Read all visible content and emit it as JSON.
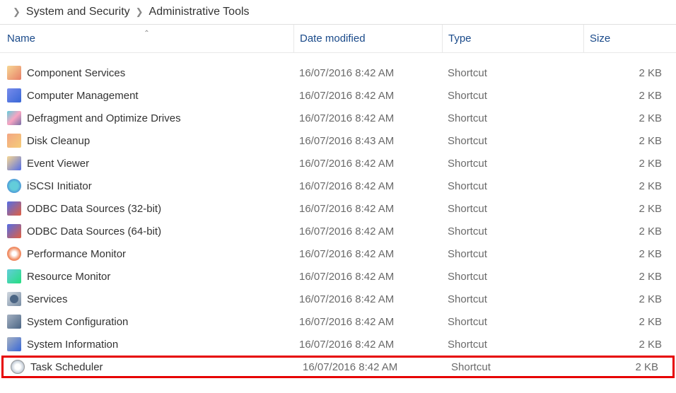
{
  "breadcrumb": {
    "segment1": "System and Security",
    "segment2": "Administrative Tools"
  },
  "columns": {
    "name": "Name",
    "date": "Date modified",
    "type": "Type",
    "size": "Size"
  },
  "items": [
    {
      "icon": "component-services-icon",
      "iconClass": "ico-component",
      "name": "Component Services",
      "date": "16/07/2016 8:42 AM",
      "type": "Shortcut",
      "size": "2 KB"
    },
    {
      "icon": "computer-management-icon",
      "iconClass": "ico-computer",
      "name": "Computer Management",
      "date": "16/07/2016 8:42 AM",
      "type": "Shortcut",
      "size": "2 KB"
    },
    {
      "icon": "defragment-icon",
      "iconClass": "ico-defrag",
      "name": "Defragment and Optimize Drives",
      "date": "16/07/2016 8:42 AM",
      "type": "Shortcut",
      "size": "2 KB"
    },
    {
      "icon": "disk-cleanup-icon",
      "iconClass": "ico-disk",
      "name": "Disk Cleanup",
      "date": "16/07/2016 8:43 AM",
      "type": "Shortcut",
      "size": "2 KB"
    },
    {
      "icon": "event-viewer-icon",
      "iconClass": "ico-event",
      "name": "Event Viewer",
      "date": "16/07/2016 8:42 AM",
      "type": "Shortcut",
      "size": "2 KB"
    },
    {
      "icon": "iscsi-initiator-icon",
      "iconClass": "ico-iscsi",
      "name": "iSCSI Initiator",
      "date": "16/07/2016 8:42 AM",
      "type": "Shortcut",
      "size": "2 KB"
    },
    {
      "icon": "odbc-32-icon",
      "iconClass": "ico-odbc",
      "name": "ODBC Data Sources (32-bit)",
      "date": "16/07/2016 8:42 AM",
      "type": "Shortcut",
      "size": "2 KB"
    },
    {
      "icon": "odbc-64-icon",
      "iconClass": "ico-odbc",
      "name": "ODBC Data Sources (64-bit)",
      "date": "16/07/2016 8:42 AM",
      "type": "Shortcut",
      "size": "2 KB"
    },
    {
      "icon": "performance-monitor-icon",
      "iconClass": "ico-perf",
      "name": "Performance Monitor",
      "date": "16/07/2016 8:42 AM",
      "type": "Shortcut",
      "size": "2 KB"
    },
    {
      "icon": "resource-monitor-icon",
      "iconClass": "ico-resource",
      "name": "Resource Monitor",
      "date": "16/07/2016 8:42 AM",
      "type": "Shortcut",
      "size": "2 KB"
    },
    {
      "icon": "services-icon",
      "iconClass": "ico-services",
      "name": "Services",
      "date": "16/07/2016 8:42 AM",
      "type": "Shortcut",
      "size": "2 KB"
    },
    {
      "icon": "system-configuration-icon",
      "iconClass": "ico-sysconfig",
      "name": "System Configuration",
      "date": "16/07/2016 8:42 AM",
      "type": "Shortcut",
      "size": "2 KB"
    },
    {
      "icon": "system-information-icon",
      "iconClass": "ico-sysinfo",
      "name": "System Information",
      "date": "16/07/2016 8:42 AM",
      "type": "Shortcut",
      "size": "2 KB"
    },
    {
      "icon": "task-scheduler-icon",
      "iconClass": "ico-tasksched",
      "name": "Task Scheduler",
      "date": "16/07/2016 8:42 AM",
      "type": "Shortcut",
      "size": "2 KB",
      "highlighted": true
    }
  ]
}
